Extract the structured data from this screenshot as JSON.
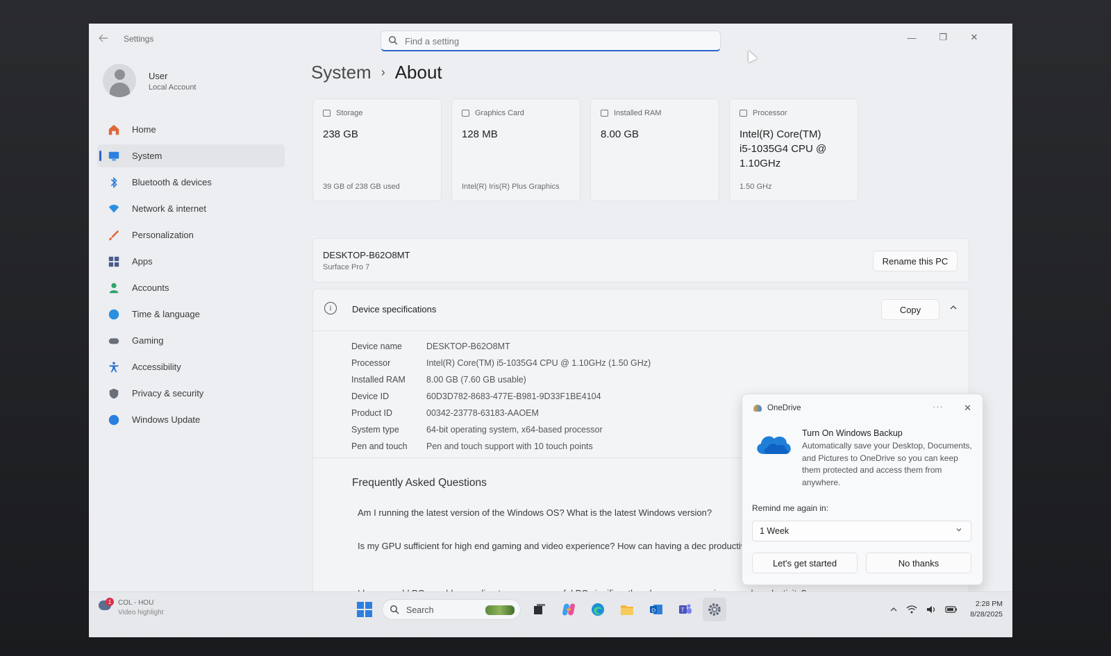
{
  "window": {
    "title": "Settings",
    "controls": {
      "minimize": "—",
      "maximize": "❐",
      "close": "✕"
    }
  },
  "search": {
    "placeholder": "Find a setting"
  },
  "profile": {
    "name": "User",
    "type": "Local Account"
  },
  "sidebar": {
    "items": [
      {
        "label": "Home",
        "icon": "home-icon",
        "color": "#e0673a",
        "active": false
      },
      {
        "label": "System",
        "icon": "monitor-icon",
        "color": "#2b7fe0",
        "active": true
      },
      {
        "label": "Bluetooth & devices",
        "icon": "bluetooth-icon",
        "color": "#2b7fe0",
        "active": false
      },
      {
        "label": "Network & internet",
        "icon": "wifi-icon",
        "color": "#2b8fe0",
        "active": false
      },
      {
        "label": "Personalization",
        "icon": "brush-icon",
        "color": "#e0673a",
        "active": false
      },
      {
        "label": "Apps",
        "icon": "apps-icon",
        "color": "#4a5a8a",
        "active": false
      },
      {
        "label": "Accounts",
        "icon": "person-icon",
        "color": "#2fa36b",
        "active": false
      },
      {
        "label": "Time & language",
        "icon": "globe-clock-icon",
        "color": "#2b8fe0",
        "active": false
      },
      {
        "label": "Gaming",
        "icon": "gamepad-icon",
        "color": "#6a6f7a",
        "active": false
      },
      {
        "label": "Accessibility",
        "icon": "accessibility-icon",
        "color": "#2b6fd0",
        "active": false
      },
      {
        "label": "Privacy & security",
        "icon": "shield-icon",
        "color": "#6a6f7a",
        "active": false
      },
      {
        "label": "Windows Update",
        "icon": "update-icon",
        "color": "#2b7fe0",
        "active": false
      }
    ]
  },
  "breadcrumb": {
    "parent": "System",
    "current": "About",
    "separator": "›"
  },
  "cards": [
    {
      "label": "Storage",
      "value": "238 GB",
      "sub": "39 GB of 238 GB used"
    },
    {
      "label": "Graphics Card",
      "value": "128 MB",
      "sub": "Intel(R) Iris(R) Plus Graphics"
    },
    {
      "label": "Installed RAM",
      "value": "8.00 GB",
      "sub": ""
    },
    {
      "label": "Processor",
      "value": "Intel(R) Core(TM) i5-1035G4 CPU @ 1.10GHz",
      "sub": "1.50 GHz"
    }
  ],
  "pc": {
    "name": "DESKTOP-B62O8MT",
    "model": "Surface Pro 7",
    "rename_label": "Rename this PC"
  },
  "specs": {
    "title": "Device specifications",
    "copy_label": "Copy",
    "rows": [
      {
        "key": "Device name",
        "value": "DESKTOP-B62O8MT"
      },
      {
        "key": "Processor",
        "value": "Intel(R) Core(TM) i5-1035G4 CPU @ 1.10GHz (1.50 GHz)"
      },
      {
        "key": "Installed RAM",
        "value": "8.00 GB (7.60 GB usable)"
      },
      {
        "key": "Device ID",
        "value": "60D3D782-8683-477E-B981-9D33F1BE4104"
      },
      {
        "key": "Product ID",
        "value": "00342-23778-63183-AAOEM"
      },
      {
        "key": "System type",
        "value": "64-bit operating system, x64-based processor"
      },
      {
        "key": "Pen and touch",
        "value": "Pen and touch support with 10 touch points"
      }
    ]
  },
  "faq": {
    "title": "Frequently Asked Questions",
    "questions": [
      "Am I running the latest version of the Windows OS? What is the latest Windows version?",
      "Is my GPU sufficient for high end gaming and video experience? How can having a dec productivity?",
      "I have an old PC, would upgrading to a more powerful PC significantly enhance my experience and productivity?"
    ]
  },
  "onedrive": {
    "brand": "OneDrive",
    "more": "···",
    "close": "✕",
    "title": "Turn On Windows Backup",
    "body": "Automatically save your Desktop, Documents, and Pictures to OneDrive so you can keep them protected and access them from anywhere.",
    "remind_label": "Remind me again in:",
    "remind_value": "1 Week",
    "primary_label": "Let's get started",
    "secondary_label": "No thanks"
  },
  "taskbar": {
    "weather_title": "COL - HOU",
    "weather_sub": "Video highlight",
    "weather_badge": "1",
    "search_label": "Search",
    "apps": [
      "task-view-icon",
      "copilot-icon",
      "edge-icon",
      "file-explorer-icon",
      "outlook-icon",
      "teams-icon",
      "settings-icon"
    ],
    "time": "2:28 PM",
    "date": "8/28/2025"
  }
}
